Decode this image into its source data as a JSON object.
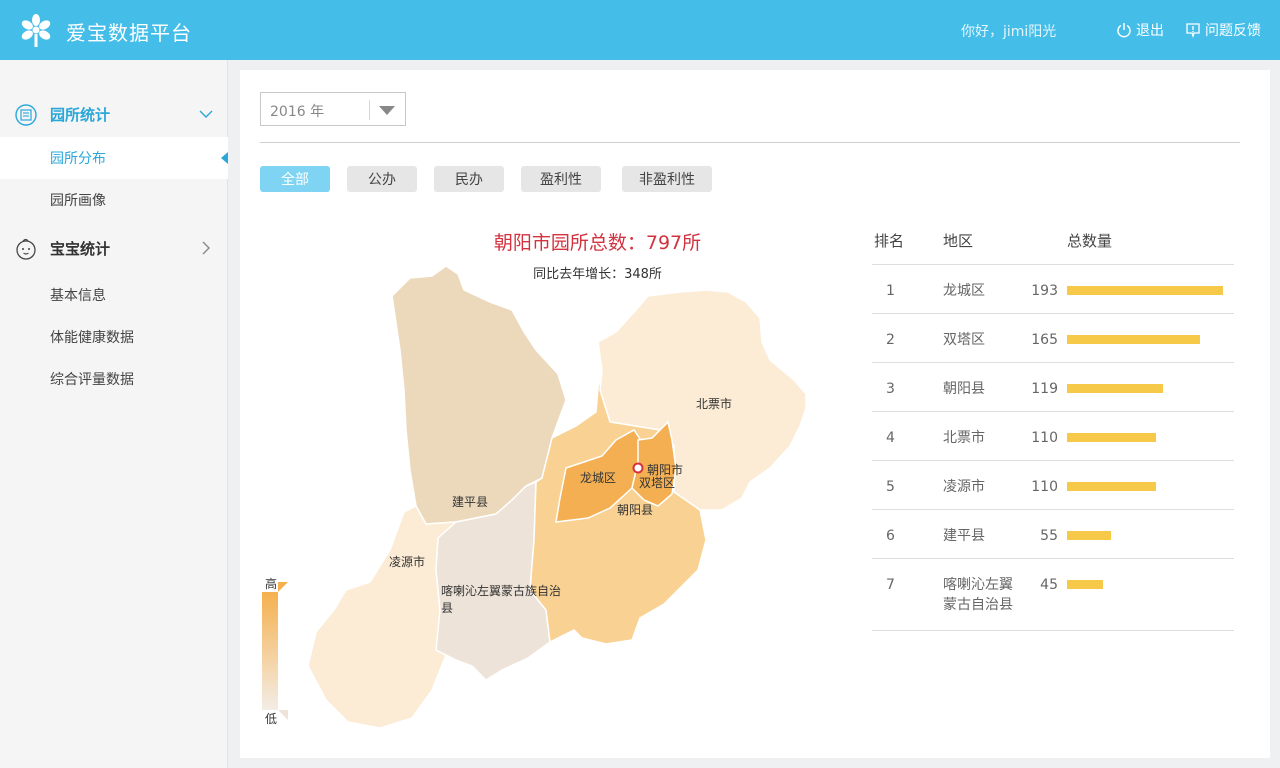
{
  "app": {
    "title": "爱宝数据平台"
  },
  "header": {
    "greeting": "你好，jimi阳光",
    "logout": "退出",
    "feedback": "问题反馈"
  },
  "sidebar": {
    "groups": [
      {
        "label": "园所统计",
        "icon": "kindergarten-icon",
        "expanded": true,
        "items": [
          {
            "label": "园所分布",
            "active": true
          },
          {
            "label": "园所画像",
            "active": false
          }
        ]
      },
      {
        "label": "宝宝统计",
        "icon": "baby-face-icon",
        "expanded": false,
        "items": [
          {
            "label": "基本信息"
          },
          {
            "label": "体能健康数据"
          },
          {
            "label": "综合评量数据"
          }
        ]
      }
    ]
  },
  "filters": {
    "year": "2016 年",
    "types": [
      {
        "label": "全部",
        "active": true
      },
      {
        "label": "公办"
      },
      {
        "label": "民办"
      },
      {
        "label": "盈利性"
      },
      {
        "label": "非盈利性"
      }
    ]
  },
  "map": {
    "title": "朝阳市园所总数：797所",
    "subtitle": "同比去年增长：348所",
    "regions": {
      "jianping": "建平县",
      "beipiao": "北票市",
      "longcheng": "龙城区",
      "chaoyang_city": "朝阳市",
      "shuangta": "双塔区",
      "chaoyang_county": "朝阳县",
      "lingyuan": "凌源市",
      "harqin_line1": "喀喇沁左翼蒙古族自治",
      "harqin_line2": "县"
    },
    "legend": {
      "high": "高",
      "low": "低"
    },
    "colors": {
      "high": "#f5b04e",
      "low": "#f3ede6"
    }
  },
  "table": {
    "headers": {
      "rank": "排名",
      "area": "地区",
      "total": "总数量"
    },
    "rows": [
      {
        "rank": "1",
        "area": "龙城区",
        "value": 193
      },
      {
        "rank": "2",
        "area": "双塔区",
        "value": 165
      },
      {
        "rank": "3",
        "area": "朝阳县",
        "value": 119
      },
      {
        "rank": "4",
        "area": "北票市",
        "value": 110
      },
      {
        "rank": "5",
        "area": "凌源市",
        "value": 110
      },
      {
        "rank": "6",
        "area": "建平县",
        "value": 55
      },
      {
        "rank": "7",
        "area": "喀喇沁左翼蒙古自治县",
        "area_line1": "喀喇沁左翼",
        "area_line2": "蒙古自治县",
        "value": 45
      }
    ],
    "bar_color": "#f7c948"
  },
  "colors": {
    "header": "#44bde8",
    "accent": "#2aa7d9",
    "title_red": "#d3323f"
  }
}
